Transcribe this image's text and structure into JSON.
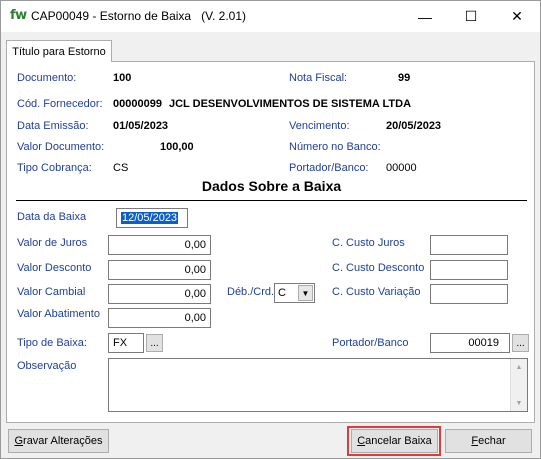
{
  "window": {
    "logo": "fw",
    "title": "CAP00049 - Estorno de Baixa   (V. 2.01)",
    "minimize_glyph": "—",
    "maximize_glyph": "☐",
    "close_glyph": "✕"
  },
  "tab": {
    "label": "Título para Estorno"
  },
  "info": {
    "documento_label": "Documento:",
    "documento_value": "100",
    "nota_fiscal_label": "Nota Fiscal:",
    "nota_fiscal_value": "99",
    "cod_fornecedor_label": "Cód. Fornecedor:",
    "cod_fornecedor_value": "00000099",
    "fornecedor_nome": "JCL DESENVOLVIMENTOS DE SISTEMA LTDA",
    "data_emissao_label": "Data Emissão:",
    "data_emissao_value": "01/05/2023",
    "vencimento_label": "Vencimento:",
    "vencimento_value": "20/05/2023",
    "valor_documento_label": "Valor Documento:",
    "valor_documento_value": "100,00",
    "numero_banco_label": "Número no Banco:",
    "numero_banco_value": "",
    "tipo_cobranca_label": "Tipo Cobrança:",
    "tipo_cobranca_value": "CS",
    "portador_label": "Portador/Banco:",
    "portador_value": "00000"
  },
  "section": {
    "heading": "Dados Sobre a Baixa"
  },
  "form": {
    "data_baixa_label": "Data da Baixa",
    "data_baixa_value": "12/05/2023",
    "valor_juros_label": "Valor de Juros",
    "valor_juros_value": "0,00",
    "valor_desconto_label": "Valor Desconto",
    "valor_desconto_value": "0,00",
    "valor_cambial_label": "Valor Cambial",
    "valor_cambial_value": "0,00",
    "valor_abatimento_label": "Valor Abatimento",
    "valor_abatimento_value": "0,00",
    "deb_crd_label": "Déb./Crd.",
    "deb_crd_value": "C",
    "c_custo_juros_label": "C. Custo Juros",
    "c_custo_juros_value": "",
    "c_custo_desconto_label": "C. Custo Desconto",
    "c_custo_desconto_value": "",
    "c_custo_variacao_label": "C. Custo Variação",
    "c_custo_variacao_value": "",
    "tipo_baixa_label": "Tipo de Baixa:",
    "tipo_baixa_value": "FX",
    "portador_banco_label": "Portador/Banco",
    "portador_banco_value": "00019",
    "observacao_label": "Observação",
    "observacao_value": "",
    "lookup_glyph": "..."
  },
  "buttons": {
    "gravar_mnemonic": "G",
    "gravar_rest": "ravar Alterações",
    "cancelar_mnemonic": "C",
    "cancelar_rest": "ancelar Baixa",
    "fechar_mnemonic": "F",
    "fechar_rest": "echar"
  },
  "colors": {
    "label_blue": "#1f3f99",
    "selection_blue": "#0b5fca",
    "highlight_red": "#e53935",
    "logo_green": "#2e7d32"
  }
}
